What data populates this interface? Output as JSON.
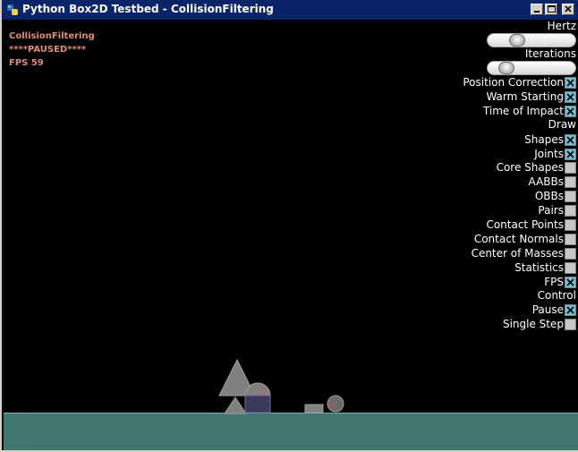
{
  "window": {
    "title": "Python Box2D Testbed - CollisionFiltering",
    "icon": "python-logo-icon",
    "controls": {
      "minimize": "minimize-icon",
      "maximize": "maximize-icon",
      "close": "close-icon"
    }
  },
  "info": {
    "test_name": "CollisionFiltering",
    "status": "****PAUSED****",
    "fps": "FPS 59"
  },
  "colors": {
    "info_text": "#e08a78",
    "checked": "#6cc3d8",
    "ground": "#407670",
    "shapes": "#808080"
  },
  "settings": {
    "hertz_label": "Hertz",
    "hertz_value": 0.3,
    "iterations_label": "Iterations",
    "iterations_value": 0.15,
    "toggles_top": [
      {
        "label": "Position Correction",
        "checked": true
      },
      {
        "label": "Warm Starting",
        "checked": true
      },
      {
        "label": "Time of Impact",
        "checked": true
      }
    ],
    "draw_label": "Draw",
    "draw_toggles": [
      {
        "label": "Shapes",
        "checked": true
      },
      {
        "label": "Joints",
        "checked": true
      },
      {
        "label": "Core Shapes",
        "checked": false
      },
      {
        "label": "AABBs",
        "checked": false
      },
      {
        "label": "OBBs",
        "checked": false
      },
      {
        "label": "Pairs",
        "checked": false
      },
      {
        "label": "Contact Points",
        "checked": false
      },
      {
        "label": "Contact Normals",
        "checked": false
      },
      {
        "label": "Center of Masses",
        "checked": false
      },
      {
        "label": "Statistics",
        "checked": false
      },
      {
        "label": "FPS",
        "checked": true
      }
    ],
    "control_label": "Control",
    "control_toggles": [
      {
        "label": "Pause",
        "checked": true
      },
      {
        "label": "Single Step",
        "checked": false
      }
    ]
  }
}
